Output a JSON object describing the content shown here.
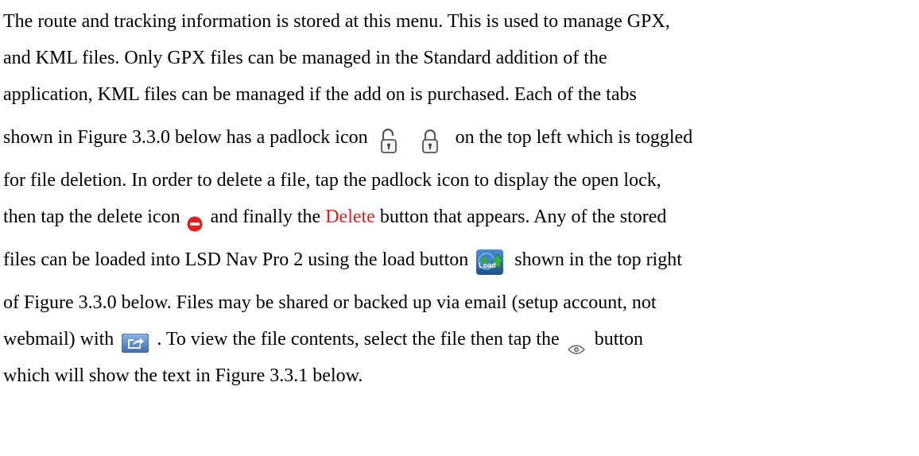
{
  "paragraph": {
    "l1": "The route and tracking information is stored at this menu. This is used to manage GPX,",
    "l2": "and KML files.  Only GPX files can be managed in the Standard addition of the",
    "l3": "application, KML files can be managed if the add on is purchased. Each of the tabs",
    "l4_pre": "shown in Figure 3.3.0 below has a padlock icon",
    "l4_post": "on the top left which is toggled",
    "l5": "for file deletion.  In order to delete a file, tap the padlock icon to display the open lock,",
    "l6_pre": "then tap the delete icon",
    "l6_mid": "and finally the",
    "l6_delete": "Delete",
    "l6_post": "button that appears.  Any of the stored",
    "l7_pre": "files can be loaded into LSD Nav Pro 2 using the load button",
    "l7_post": "shown in the top right",
    "l8": "of Figure 3.3.0 below.  Files may be shared or backed up  via email (setup account, not",
    "l9_pre": "webmail) with",
    "l9_post": ".  To view the file contents, select the file then tap the",
    "l9_end": "button",
    "l10": "which will show the text in Figure 3.3.1 below."
  },
  "icons": {
    "padlock_open": "padlock-open-icon",
    "padlock_closed": "padlock-closed-icon",
    "delete": "delete-icon",
    "load": "load-icon",
    "load_label": "Load",
    "share": "share-icon",
    "eye": "eye-icon"
  },
  "colors": {
    "delete_red": "#e0201b",
    "load_green": "#2e9d3a",
    "load_blue": "#2a6fbf"
  }
}
